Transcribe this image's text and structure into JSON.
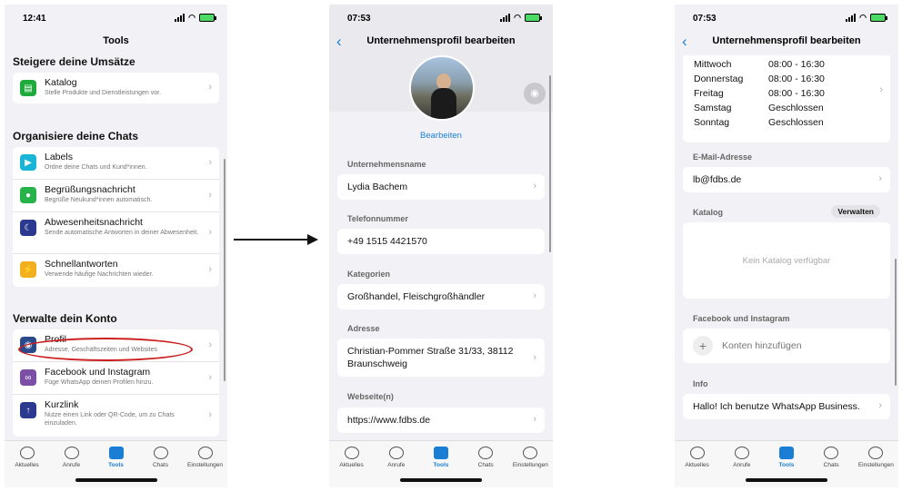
{
  "screen1": {
    "time": "12:41",
    "title": "Tools",
    "sections": [
      {
        "heading": "Steigere deine Umsätze",
        "items": [
          {
            "title": "Katalog",
            "subtitle": "Stelle Produkte und Dienstleistungen vor.",
            "icon": "catalog-icon",
            "color": "#1faa3c"
          }
        ]
      },
      {
        "heading": "Organisiere deine Chats",
        "items": [
          {
            "title": "Labels",
            "subtitle": "Ordne deine Chats und Kund*innen.",
            "icon": "label-icon",
            "color": "#19b4d8"
          },
          {
            "title": "Begrüßungsnachricht",
            "subtitle": "Begrüße Neukund*innen automatisch.",
            "icon": "chat-bubble-icon",
            "color": "#25b34a"
          },
          {
            "title": "Abwesenheitsnachricht",
            "subtitle": "Sende automatische Antworten in deiner Abwesenheit.",
            "icon": "moon-icon",
            "color": "#2b3a8f"
          },
          {
            "title": "Schnellantworten",
            "subtitle": "Verwende häufige Nachrichten wieder.",
            "icon": "lightning-icon",
            "color": "#f2b01e"
          }
        ]
      },
      {
        "heading": "Verwalte dein Konto",
        "items": [
          {
            "title": "Profil",
            "subtitle": "Adresse, Geschäftszeiten und Websites",
            "icon": "store-icon",
            "color": "#2a4a8c"
          },
          {
            "title": "Facebook und Instagram",
            "subtitle": "Füge WhatsApp deinen Profilen hinzu.",
            "icon": "meta-icon",
            "color": "#7b4fa5"
          },
          {
            "title": "Kurzlink",
            "subtitle": "Nutze einen Link oder QR-Code, um zu Chats einzuladen.",
            "icon": "share-icon",
            "color": "#2b3a8f"
          }
        ]
      }
    ]
  },
  "tabs": [
    "Aktuelles",
    "Anrufe",
    "Tools",
    "Chats",
    "Einstellungen"
  ],
  "screen2": {
    "time": "07:53",
    "title": "Unternehmensprofil bearbeiten",
    "edit_label": "Bearbeiten",
    "fields": [
      {
        "label": "Unternehmensname",
        "value": "Lydia Bachem",
        "chevron": true
      },
      {
        "label": "Telefonnummer",
        "value": "+49 1515 4421570",
        "chevron": false
      },
      {
        "label": "Kategorien",
        "value": "Großhandel, Fleischgroßhändler",
        "chevron": true
      },
      {
        "label": "Adresse",
        "value": "Christian-Pommer Straße 31/33, 38112 Braunschweig",
        "chevron": true
      },
      {
        "label": "Webseite(n)",
        "value": "https://www.fdbs.de",
        "chevron": true
      }
    ]
  },
  "screen3": {
    "time": "07:53",
    "title": "Unternehmensprofil bearbeiten",
    "hours": [
      {
        "day": "Mittwoch",
        "time": "08:00 - 16:30"
      },
      {
        "day": "Donnerstag",
        "time": "08:00 - 16:30"
      },
      {
        "day": "Freitag",
        "time": "08:00 - 16:30"
      },
      {
        "day": "Samstag",
        "time": "Geschlossen"
      },
      {
        "day": "Sonntag",
        "time": "Geschlossen"
      }
    ],
    "email_label": "E-Mail-Adresse",
    "email": "lb@fdbs.de",
    "catalog_label": "Katalog",
    "catalog_manage": "Verwalten",
    "catalog_empty": "Kein Katalog verfügbar",
    "social_label": "Facebook und Instagram",
    "social_add": "Konten hinzufügen",
    "info_label": "Info",
    "info_value": "Hallo! Ich benutze WhatsApp Business."
  }
}
